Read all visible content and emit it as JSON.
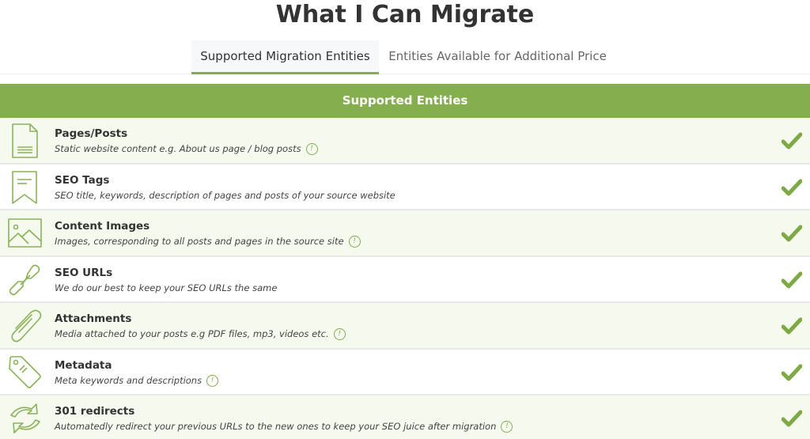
{
  "page": {
    "title": "What I Can Migrate"
  },
  "tabs": [
    {
      "label": "Supported Migration Entities",
      "active": true
    },
    {
      "label": "Entities Available for Additional Price",
      "active": false
    }
  ],
  "table": {
    "header": "Supported Entities",
    "accent_color": "#85ae4f",
    "rows": [
      {
        "icon": "document-icon",
        "title": "Pages/Posts",
        "description": "Static website content e.g. About us page / blog posts",
        "info": true,
        "supported": true
      },
      {
        "icon": "bookmark-icon",
        "title": "SEO Tags",
        "description": "SEO title, keywords, description of pages and posts of your source website",
        "info": false,
        "supported": true
      },
      {
        "icon": "image-icon",
        "title": "Content Images",
        "description": "Images, corresponding to all posts and pages in the source site",
        "info": true,
        "supported": true
      },
      {
        "icon": "link-icon",
        "title": "SEO URLs",
        "description": "We do our best to keep your SEO URLs the same",
        "info": false,
        "supported": true
      },
      {
        "icon": "paperclip-icon",
        "title": "Attachments",
        "description": "Media attached to your posts e.g PDF files, mp3, videos etc.",
        "info": true,
        "supported": true
      },
      {
        "icon": "tag-icon",
        "title": "Metadata",
        "description": "Meta keywords and descriptions",
        "info": true,
        "supported": true
      },
      {
        "icon": "redirect-icon",
        "title": "301 redirects",
        "description": "Automatedly redirect your previous URLs to the new ones to keep your SEO juice after migration",
        "info": true,
        "supported": true
      }
    ],
    "info_glyph": "!"
  }
}
